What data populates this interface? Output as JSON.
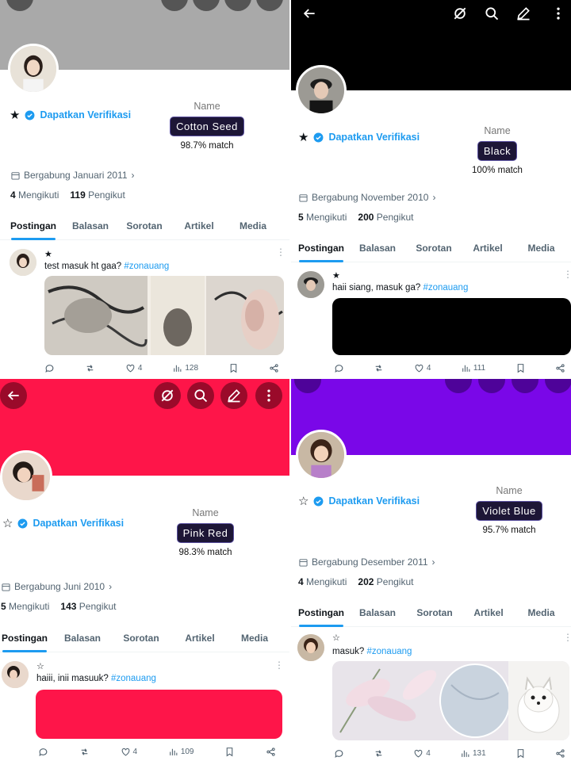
{
  "verify_label": "Dapatkan Verifikasi",
  "name_label": "Name",
  "tabs": [
    "Postingan",
    "Balasan",
    "Sorotan",
    "Artikel",
    "Media"
  ],
  "following_label": "Mengikuti",
  "followers_label": "Pengikut",
  "panels": [
    {
      "id": "tl",
      "banner_color": "#a9a9a9",
      "star": "★",
      "color_name": "Cotton Seed",
      "match": "98.7% match",
      "joined": "Bergabung Januari 2011",
      "following": "4",
      "followers": "119",
      "post_star": "★",
      "post_text": "test masuk ht gaa?",
      "hashtag": "#zonauang",
      "likes": "4",
      "views": "128"
    },
    {
      "id": "tr",
      "banner_color": "#000000",
      "star": "★",
      "color_name": "Black",
      "match": "100% match",
      "joined": "Bergabung November 2010",
      "following": "5",
      "followers": "200",
      "post_star": "★",
      "post_text": "haii siang, masuk ga?",
      "hashtag": "#zonauang",
      "media_color": "#000000",
      "likes": "4",
      "views": "111"
    },
    {
      "id": "bl",
      "banner_color": "#fe1549",
      "star": "☆",
      "color_name": "Pink Red",
      "match": "98.3% match",
      "joined": "Bergabung Juni 2010",
      "following": "5",
      "followers": "143",
      "post_star": "☆",
      "post_text": "haiii, inii masuuk?",
      "hashtag": "#zonauang",
      "media_color": "#fe1549",
      "likes": "4",
      "views": "109"
    },
    {
      "id": "br",
      "banner_color": "#7a07e8",
      "star": "☆",
      "color_name": "Violet Blue",
      "match": "95.7% match",
      "joined": "Bergabung Desember 2011",
      "following": "4",
      "followers": "202",
      "post_star": "☆",
      "post_text": "masuk?",
      "hashtag": "#zonauang",
      "likes": "4",
      "views": "131"
    }
  ],
  "colors": {
    "accent": "#1d9bf0",
    "chip_bg": "#1d1636",
    "muted": "#536471"
  },
  "icons": [
    "back-arrow-icon",
    "hide-icon",
    "search-icon",
    "edit-icon",
    "more-icon",
    "verified-badge-icon",
    "calendar-icon",
    "chevron-right-icon",
    "reply-icon",
    "retweet-icon",
    "like-icon",
    "views-icon",
    "bookmark-icon",
    "share-icon"
  ]
}
